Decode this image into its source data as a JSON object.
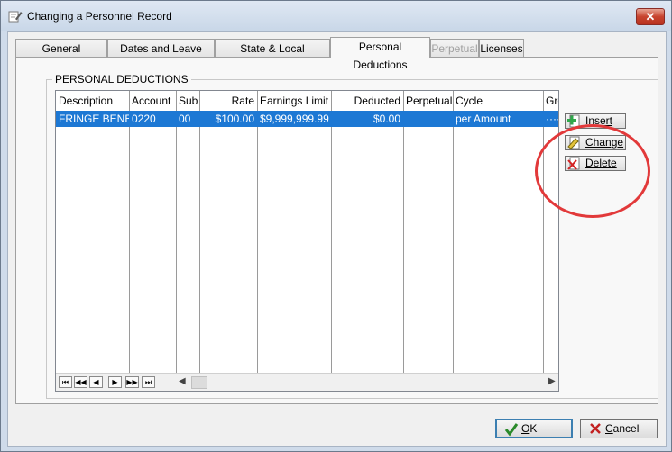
{
  "window": {
    "title": "Changing a Personnel Record",
    "close_glyph": "✕"
  },
  "tabs": [
    {
      "label": "General Informaton",
      "state": "normal"
    },
    {
      "label": "Dates and Leave Time",
      "state": "normal"
    },
    {
      "label": "State & Local Information",
      "state": "normal"
    },
    {
      "label": "Personal Deductions",
      "state": "active"
    },
    {
      "label": "Perpetual",
      "state": "disabled"
    },
    {
      "label": "Licenses",
      "state": "normal"
    }
  ],
  "section": {
    "title": "PERSONAL DEDUCTIONS"
  },
  "grid": {
    "columns": [
      "Description",
      "Account",
      "Sub",
      "Rate",
      "Earnings Limit",
      "Deducted",
      "Perpetual",
      "Cycle",
      "Gro"
    ],
    "rows": [
      {
        "description": "FRINGE BENEF",
        "account": "0220",
        "sub": "00",
        "rate": "$100.00",
        "earnings_limit": "$9,999,999.99",
        "deducted": "$0.00",
        "perpetual": "",
        "cycle": "per Amount",
        "gro": "····"
      }
    ],
    "nav": {
      "first": "⏮",
      "prev_page": "◀◀",
      "prev": "◀",
      "next": "▶",
      "next_page": "▶▶",
      "last": "⏭"
    },
    "scroll_left": "◀",
    "scroll_right": "▶"
  },
  "actions": {
    "insert": "Insert",
    "change": "Change",
    "delete": "Delete"
  },
  "footer": {
    "ok_mnemonic": "O",
    "ok_rest": "K",
    "cancel_mnemonic": "C",
    "cancel_rest": "ancel"
  },
  "colors": {
    "selection": "#1d78d4",
    "highlight_ring": "#e2393a",
    "close_button": "#c8442f"
  }
}
